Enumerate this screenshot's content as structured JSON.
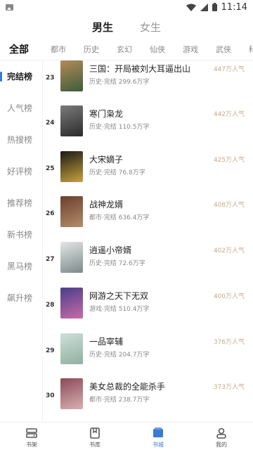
{
  "status": {
    "time": "11:14"
  },
  "gender_tabs": [
    "男生",
    "女生"
  ],
  "category_tabs": [
    "全部",
    "都市",
    "历史",
    "玄幻",
    "仙侠",
    "游戏",
    "武侠",
    "科幻"
  ],
  "rank_types": [
    "完结榜",
    "人气榜",
    "热搜榜",
    "好评榜",
    "推荐榜",
    "新书榜",
    "黑马榜",
    "飙升榜"
  ],
  "books": [
    {
      "rank": "23",
      "title": "三国：开局被刘大耳逼出山",
      "meta": "历史·完结 299.6万字",
      "hot": "447万人气",
      "cover_colors": [
        "#b58a5a",
        "#3d5c3a"
      ]
    },
    {
      "rank": "24",
      "title": "寒门枭龙",
      "meta": "历史·完结 110.5万字",
      "hot": "442万人气",
      "cover_colors": [
        "#7a7a7a",
        "#2b2b2b"
      ]
    },
    {
      "rank": "25",
      "title": "大宋嫡子",
      "meta": "历史·完结 76.8万字",
      "hot": "425万人气",
      "cover_colors": [
        "#1a1a1a",
        "#c9a23a"
      ]
    },
    {
      "rank": "26",
      "title": "战神龙婿",
      "meta": "都市·完结 636.4万字",
      "hot": "408万人气",
      "cover_colors": [
        "#6a3f2e",
        "#b38d6a"
      ]
    },
    {
      "rank": "27",
      "title": "逍遥小帝婿",
      "meta": "历史·完结 72.6万字",
      "hot": "402万人气",
      "cover_colors": [
        "#e6e6e6",
        "#7a8a8a"
      ]
    },
    {
      "rank": "28",
      "title": "网游之天下无双",
      "meta": "游戏·完结 510.4万字",
      "hot": "400万人气",
      "cover_colors": [
        "#4a3e8a",
        "#c86aa8"
      ]
    },
    {
      "rank": "29",
      "title": "一品宰辅",
      "meta": "历史·完结 204.7万字",
      "hot": "376万人气",
      "cover_colors": [
        "#cfe0d8",
        "#8fb0a0"
      ]
    },
    {
      "rank": "30",
      "title": "美女总裁的全能杀手",
      "meta": "都市·完结 238.7万字",
      "hot": "373万人气",
      "cover_colors": [
        "#8a4a5a",
        "#d8b0b0"
      ]
    }
  ],
  "bottom_nav": [
    "书架",
    "书库",
    "书城",
    "我的"
  ],
  "colors": {
    "accent": "#3a7bd5",
    "hot": "#c8aa86"
  }
}
